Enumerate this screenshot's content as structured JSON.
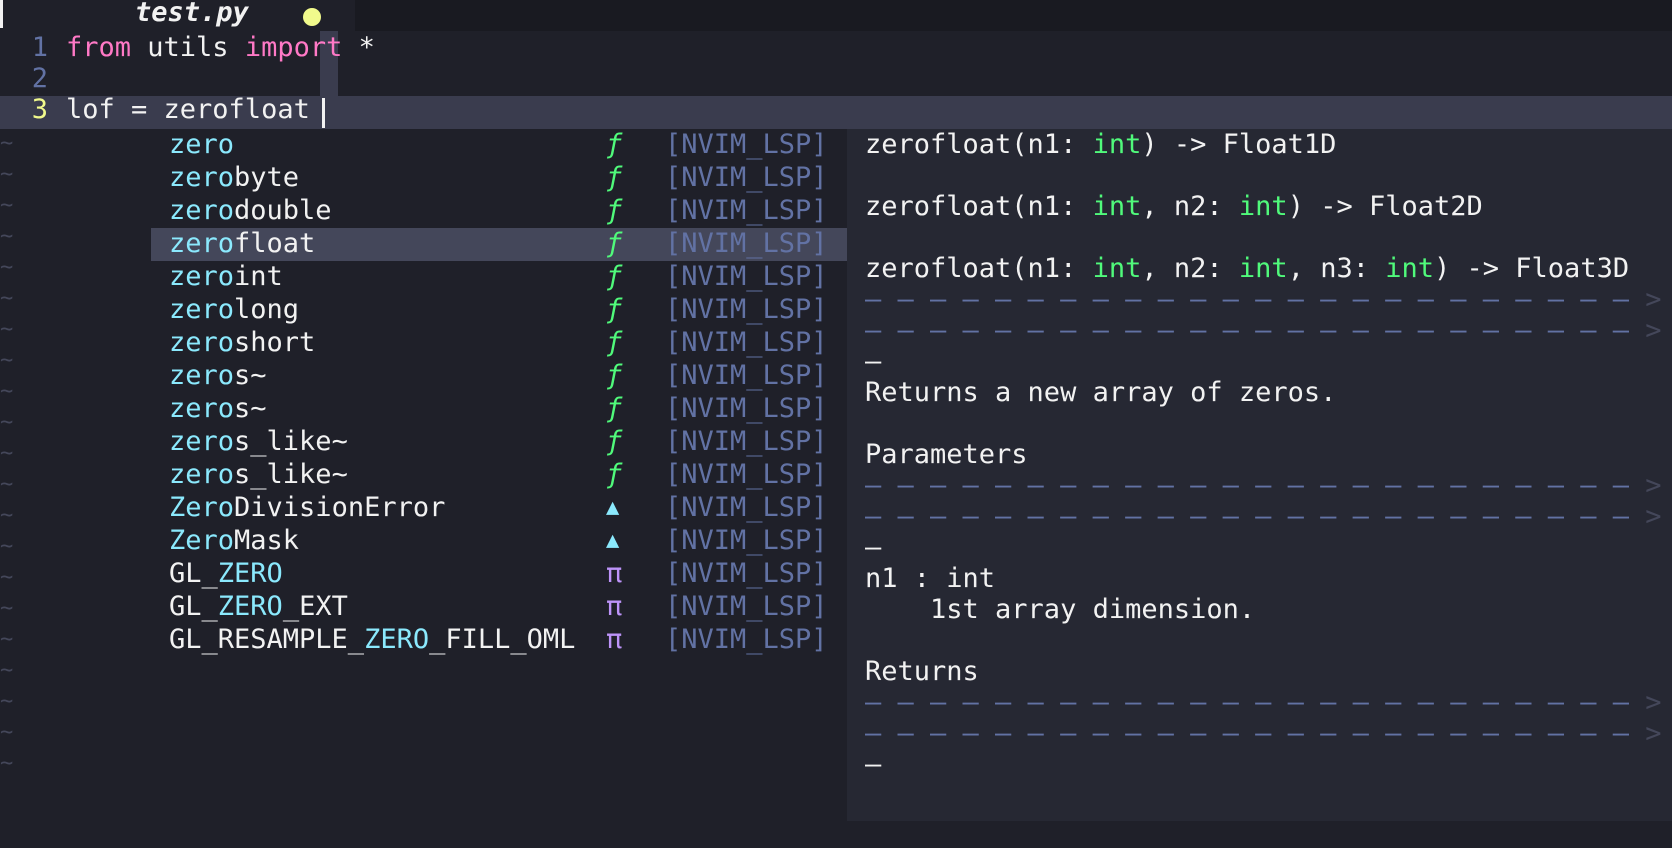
{
  "tab": {
    "title": "test.py"
  },
  "editor": {
    "lines": [
      {
        "num": "1",
        "tokens": [
          {
            "t": "from",
            "kw": true
          },
          {
            "t": " utils "
          },
          {
            "t": "import",
            "kw": true
          },
          {
            "t": " *"
          }
        ]
      },
      {
        "num": "2",
        "tokens": []
      },
      {
        "num": "3",
        "tokens": [
          {
            "t": "lof = zerofloat"
          }
        ]
      }
    ],
    "tilde": "~"
  },
  "completion": {
    "items": [
      {
        "match": "zero",
        "rest": "",
        "kind": "ƒ",
        "kind_type": "f",
        "source": "[NVIM_LSP]"
      },
      {
        "match": "zero",
        "rest": "byte",
        "kind": "ƒ",
        "kind_type": "f",
        "source": "[NVIM_LSP]"
      },
      {
        "match": "zero",
        "rest": "double",
        "kind": "ƒ",
        "kind_type": "f",
        "source": "[NVIM_LSP]"
      },
      {
        "match": "zero",
        "rest": "float",
        "kind": "ƒ",
        "kind_type": "f",
        "source": "[NVIM_LSP]",
        "selected": true
      },
      {
        "match": "zero",
        "rest": "int",
        "kind": "ƒ",
        "kind_type": "f",
        "source": "[NVIM_LSP]"
      },
      {
        "match": "zero",
        "rest": "long",
        "kind": "ƒ",
        "kind_type": "f",
        "source": "[NVIM_LSP]"
      },
      {
        "match": "zero",
        "rest": "short",
        "kind": "ƒ",
        "kind_type": "f",
        "source": "[NVIM_LSP]"
      },
      {
        "match": "zero",
        "rest": "s~",
        "kind": "ƒ",
        "kind_type": "f",
        "source": "[NVIM_LSP]"
      },
      {
        "match": "zero",
        "rest": "s~",
        "kind": "ƒ",
        "kind_type": "f",
        "source": "[NVIM_LSP]"
      },
      {
        "match": "zero",
        "rest": "s_like~",
        "kind": "ƒ",
        "kind_type": "f",
        "source": "[NVIM_LSP]"
      },
      {
        "match": "zero",
        "rest": "s_like~",
        "kind": "ƒ",
        "kind_type": "f",
        "source": "[NVIM_LSP]"
      },
      {
        "match": "Zero",
        "rest": "DivisionError",
        "kind": "▲",
        "kind_type": "cls",
        "source": "[NVIM_LSP]"
      },
      {
        "match": "Zero",
        "rest": "Mask",
        "kind": "▲",
        "kind_type": "cls",
        "source": "[NVIM_LSP]"
      },
      {
        "pre": "GL_",
        "match": "ZERO",
        "rest": "",
        "kind": "π",
        "kind_type": "pi",
        "source": "[NVIM_LSP]"
      },
      {
        "pre": "GL_",
        "match": "ZERO",
        "rest": "_EXT",
        "kind": "π",
        "kind_type": "pi",
        "source": "[NVIM_LSP]"
      },
      {
        "pre": "GL_RESAMPLE_",
        "match": "ZERO",
        "rest": "_FILL_OML",
        "kind": "π",
        "kind_type": "pi",
        "source": "[NVIM_LSP]"
      }
    ]
  },
  "doc": {
    "lines": [
      {
        "segs": [
          {
            "t": "zerofloat(n1: "
          },
          {
            "t": "int",
            "ty": true
          },
          {
            "t": ") -> Float1D"
          }
        ]
      },
      {
        "segs": []
      },
      {
        "segs": [
          {
            "t": "zerofloat(n1: "
          },
          {
            "t": "int",
            "ty": true
          },
          {
            "t": ", n2: "
          },
          {
            "t": "int",
            "ty": true
          },
          {
            "t": ") -> Float2D"
          }
        ]
      },
      {
        "segs": []
      },
      {
        "segs": [
          {
            "t": "zerofloat(n1: "
          },
          {
            "t": "int",
            "ty": true
          },
          {
            "t": ", n2: "
          },
          {
            "t": "int",
            "ty": true
          },
          {
            "t": ", n3: "
          },
          {
            "t": "int",
            "ty": true
          },
          {
            "t": ") -> Float3D"
          }
        ]
      },
      {
        "dash": true
      },
      {
        "dash": true
      },
      {
        "segs": [
          {
            "t": "—"
          }
        ]
      },
      {
        "segs": [
          {
            "t": "Returns a new array of zeros."
          }
        ]
      },
      {
        "segs": []
      },
      {
        "segs": [
          {
            "t": "Parameters"
          }
        ]
      },
      {
        "dash": true
      },
      {
        "dash": true
      },
      {
        "segs": [
          {
            "t": "—"
          }
        ]
      },
      {
        "segs": [
          {
            "t": "n1 : int"
          }
        ]
      },
      {
        "segs": [
          {
            "t": "    1st array dimension."
          }
        ]
      },
      {
        "segs": []
      },
      {
        "segs": [
          {
            "t": "Returns"
          }
        ]
      },
      {
        "dash": true
      },
      {
        "dash": true
      },
      {
        "segs": [
          {
            "t": "—"
          }
        ]
      }
    ],
    "dash_text": "— — — — — — — — — — — — — — — — — — — — — — — —",
    "dash_tail": " >"
  },
  "colors": {
    "background": "#1f2029",
    "keyword": "#ff79c6",
    "match": "#8be9fd",
    "function_kind": "#50fa7b",
    "constant_kind": "#bd93f9",
    "source": "#6272a4",
    "selection": "#44475a",
    "modified_dot": "#f1fa8c"
  }
}
